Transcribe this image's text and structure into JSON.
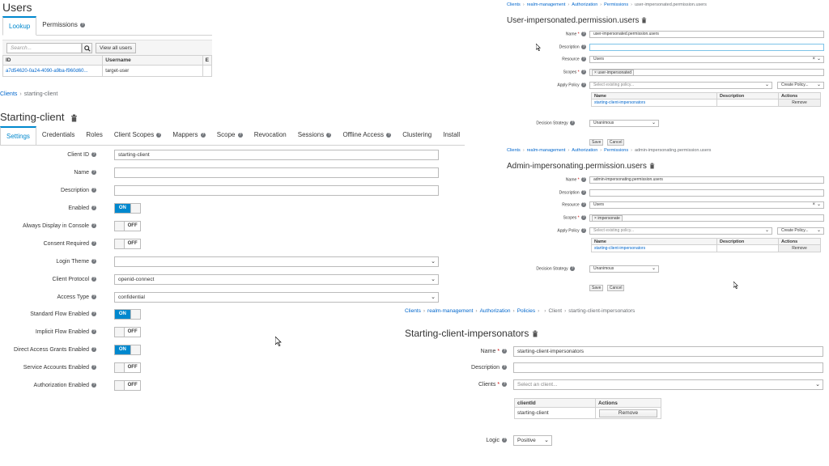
{
  "users": {
    "title": "Users",
    "tabs": [
      "Lookup",
      "Permissions"
    ],
    "search_placeholder": "Search...",
    "view_all_label": "View all users",
    "columns": [
      "ID",
      "Username",
      "E"
    ],
    "row": {
      "id": "a7d54620-0a24-4090-a9ba-f960d60...",
      "username": "target-user"
    }
  },
  "client": {
    "breadcrumb": [
      "Clients",
      "starting-client"
    ],
    "title": "Starting-client",
    "tabs": [
      "Settings",
      "Credentials",
      "Roles",
      "Client Scopes",
      "Mappers",
      "Scope",
      "Revocation",
      "Sessions",
      "Offline Access",
      "Clustering",
      "Install"
    ],
    "fields": {
      "client_id_label": "Client ID",
      "client_id": "starting-client",
      "name_label": "Name",
      "description_label": "Description",
      "enabled_label": "Enabled",
      "always_display_label": "Always Display in Console",
      "consent_label": "Consent Required",
      "login_theme_label": "Login Theme",
      "protocol_label": "Client Protocol",
      "protocol": "openid-connect",
      "access_type_label": "Access Type",
      "access_type": "confidential",
      "standard_flow_label": "Standard Flow Enabled",
      "implicit_flow_label": "Implicit Flow Enabled",
      "direct_access_label": "Direct Access Grants Enabled",
      "service_accounts_label": "Service Accounts Enabled",
      "authorization_label": "Authorization Enabled"
    },
    "on": "ON",
    "off": "OFF"
  },
  "perm1": {
    "breadcrumb": [
      "Clients",
      "realm-management",
      "Authorization",
      "Permissions",
      "user-impersonated.permission.users"
    ],
    "title": "User-impersonated.permission.users",
    "name_label": "Name",
    "name": "user-impersonated.permission.users",
    "description_label": "Description",
    "resource_label": "Resource",
    "resource": "Users",
    "scopes_label": "Scopes",
    "scope": "user-impersonated",
    "apply_policy_label": "Apply Policy",
    "select_policy": "Select existing policy...",
    "create_policy": "Create Policy...",
    "table_headers": [
      "Name",
      "Description",
      "Actions"
    ],
    "policy_row": "starting-client-impersonators",
    "remove": "Remove",
    "decision_label": "Decision Strategy",
    "decision": "Unanimous",
    "save": "Save",
    "cancel": "Cancel"
  },
  "perm2": {
    "breadcrumb": [
      "Clients",
      "realm-management",
      "Authorization",
      "Permissions",
      "admin-impersonating.permission.users"
    ],
    "title": "Admin-impersonating.permission.users",
    "name_label": "Name",
    "name": "admin-impersonating.permission.users",
    "description_label": "Description",
    "resource_label": "Resource",
    "resource": "Users",
    "scopes_label": "Scopes",
    "scope": "impersonate",
    "apply_policy_label": "Apply Policy",
    "select_policy": "Select existing policy...",
    "create_policy": "Create Policy...",
    "table_headers": [
      "Name",
      "Description",
      "Actions"
    ],
    "policy_row": "starting-client-impersonators",
    "remove": "Remove",
    "decision_label": "Decision Strategy",
    "decision": "Unanimous",
    "save": "Save",
    "cancel": "Cancel"
  },
  "policy": {
    "breadcrumb": [
      "Clients",
      "realm-management",
      "Authorization",
      "Policies",
      "",
      "Client",
      "starting-client-impersonators"
    ],
    "title": "Starting-client-impersonators",
    "name_label": "Name",
    "name": "starting-client-impersonators",
    "description_label": "Description",
    "clients_label": "Clients",
    "clients_placeholder": "Select an client...",
    "table_headers": [
      "clientId",
      "Actions"
    ],
    "client_row": "starting-client",
    "remove": "Remove",
    "logic_label": "Logic",
    "logic": "Positive"
  },
  "colors": {
    "accent": "#0088ce",
    "link": "#0066cc"
  }
}
